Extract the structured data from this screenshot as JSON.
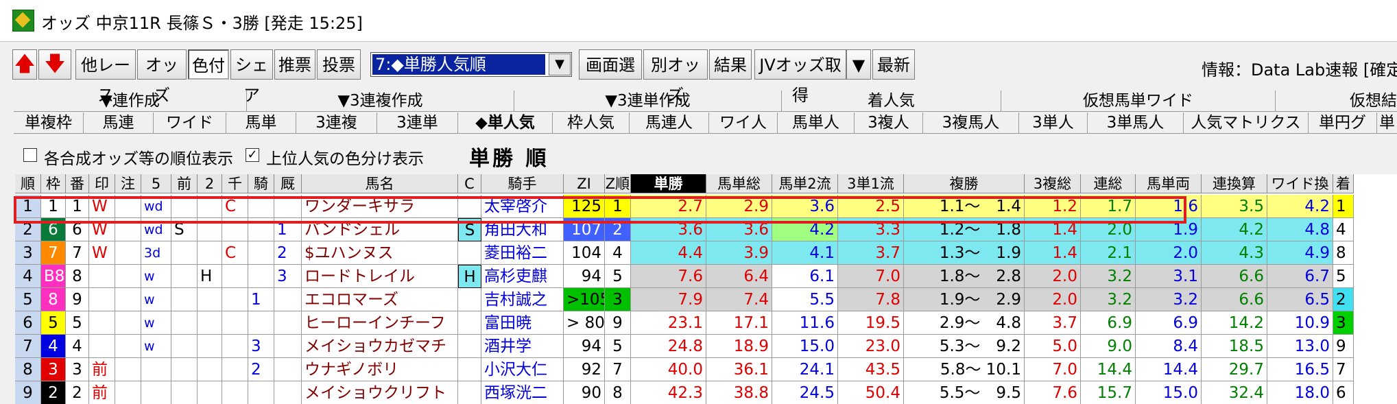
{
  "window": {
    "title": "オッズ 中京11R 長篠Ｓ・3勝 [発走 15:25]",
    "icon": "app-horse-icon"
  },
  "toolbar": {
    "up_icon": "arrow-up-icon",
    "down_icon": "arrow-down-icon",
    "other_race": "他レース",
    "odds": "オッズ",
    "color": "色付",
    "share": "シェア",
    "recommend": "推票",
    "vote": "投票",
    "sort_mode": "7:◆単勝人気順",
    "screen_select": "画面選",
    "other_odds": "別オッズ",
    "result": "結果",
    "jv_odds": "JVオッズ取得",
    "latest": "最新",
    "info": "情報：Data Lab速報 [確定"
  },
  "tabs_upper": [
    "▼連作成",
    "▼3連複作成",
    "▼3連単作成",
    "着人気",
    "仮想馬単ワイド",
    "仮想結"
  ],
  "tabs_lower": [
    "単複枠",
    "馬連",
    "ワイド",
    "馬単",
    "3連複",
    "3連単",
    "◆単人気",
    "枠人気",
    "馬連人",
    "ワイ人",
    "馬単人",
    "3複人",
    "3複馬人",
    "3単人",
    "3単馬人",
    "人気マトリクス",
    "単円グ",
    "単"
  ],
  "options": {
    "rank_display": "各合成オッズ等の順位表示",
    "rank_checked": false,
    "color_top": "上位人気の色分け表示",
    "color_checked": true,
    "heading": "単勝 順"
  },
  "colors": {
    "yellow": "#ffff80",
    "cyan": "#7de8f0",
    "green": "#a0ff80",
    "gray": "#d4d4d4",
    "red": "#e00000",
    "blue": "#0000e0",
    "dred": "#800000"
  },
  "columns": [
    "順",
    "枠",
    "番",
    "印",
    "注",
    "5",
    "前",
    "2",
    "千",
    "騎",
    "厩",
    "馬名",
    "C",
    "騎手",
    "ZI",
    "Z順",
    "単勝",
    "馬単総",
    "馬単2流",
    "3単1流",
    "複勝",
    "3複総",
    "連総",
    "馬単両",
    "連換算",
    "ワイド換",
    "着"
  ],
  "rows": [
    {
      "rank": "1",
      "waku": "1",
      "ban": "1",
      "mark": "W",
      "note": "",
      "c5": "wd",
      "mae": "",
      "c2": "",
      "sen": "C",
      "kisha": "",
      "kyu": "",
      "horse": "ワンダーキサラ",
      "c": "",
      "jockey": "太宰啓介",
      "zi": "125",
      "zr": "1",
      "win": "2.7",
      "umatan": "2.9",
      "u2": "3.6",
      "s1": "2.5",
      "place": "1.1～　1.4",
      "f3": "1.2",
      "ren": "1.7",
      "ryo": "1.6",
      "kan": "3.5",
      "wide": "4.2",
      "chaku": "1"
    },
    {
      "rank": "2",
      "waku": "6",
      "ban": "6",
      "mark": "W",
      "note": "",
      "c5": "wd",
      "mae": "S",
      "c2": "",
      "sen": "",
      "kisha": "",
      "kyu": "1",
      "horse": "バンドシェル",
      "c": "S",
      "jockey": "角田大和",
      "zi": "107",
      "zr": "2",
      "win": "3.6",
      "umatan": "3.6",
      "u2": "4.2",
      "s1": "3.3",
      "place": "1.2～　1.8",
      "f3": "1.4",
      "ren": "2.0",
      "ryo": "1.9",
      "kan": "4.2",
      "wide": "4.8",
      "chaku": "4"
    },
    {
      "rank": "3",
      "waku": "7",
      "ban": "7",
      "mark": "W",
      "note": "",
      "c5": "3d",
      "mae": "",
      "c2": "",
      "sen": "C",
      "kisha": "",
      "kyu": "2",
      "horse": "$ユハンヌス",
      "c": "",
      "jockey": "菱田裕二",
      "zi": "104",
      "zr": "4",
      "win": "4.4",
      "umatan": "3.9",
      "u2": "4.1",
      "s1": "3.7",
      "place": "1.3～　1.9",
      "f3": "1.4",
      "ren": "2.1",
      "ryo": "2.0",
      "kan": "4.3",
      "wide": "4.9",
      "chaku": "8"
    },
    {
      "rank": "4",
      "waku": "B8",
      "ban": "8",
      "mark": "",
      "note": "",
      "c5": "w",
      "mae": "",
      "c2": "H",
      "sen": "",
      "kisha": "",
      "kyu": "3",
      "horse": "ロードトレイル",
      "c": "H",
      "jockey": "高杉吏麒",
      "zi": "94",
      "zr": "5",
      "win": "7.6",
      "umatan": "6.4",
      "u2": "6.1",
      "s1": "7.0",
      "place": "1.8～　2.8",
      "f3": "2.0",
      "ren": "3.2",
      "ryo": "3.1",
      "kan": "6.6",
      "wide": "6.7",
      "chaku": "5"
    },
    {
      "rank": "5",
      "waku": "8",
      "ban": "9",
      "mark": "",
      "note": "",
      "c5": "w",
      "mae": "",
      "c2": "",
      "sen": "",
      "kisha": "1",
      "kyu": "",
      "horse": "エコロマーズ",
      "c": "",
      "jockey": "吉村誠之",
      "zi": ">105",
      "zr": "3",
      "win": "7.9",
      "umatan": "7.4",
      "u2": "5.5",
      "s1": "7.8",
      "place": "1.9～　2.9",
      "f3": "2.0",
      "ren": "3.2",
      "ryo": "3.2",
      "kan": "6.6",
      "wide": "6.5",
      "chaku": "2"
    },
    {
      "rank": "6",
      "waku": "5",
      "ban": "5",
      "mark": "",
      "note": "",
      "c5": "w",
      "mae": "",
      "c2": "",
      "sen": "",
      "kisha": "",
      "kyu": "",
      "horse": "ヒーローインチーフ",
      "c": "",
      "jockey": "富田暁",
      "zi": "> 80",
      "zr": "9",
      "win": "23.1",
      "umatan": "17.1",
      "u2": "11.6",
      "s1": "19.5",
      "place": "2.9～　4.8",
      "f3": "3.7",
      "ren": "6.9",
      "ryo": "6.9",
      "kan": "14.2",
      "wide": "10.9",
      "chaku": "3"
    },
    {
      "rank": "7",
      "waku": "4",
      "ban": "4",
      "mark": "",
      "note": "",
      "c5": "w",
      "mae": "",
      "c2": "",
      "sen": "",
      "kisha": "3",
      "kyu": "",
      "horse": "メイショウカゼマチ",
      "c": "",
      "jockey": "酒井学",
      "zi": "94",
      "zr": "5",
      "win": "24.8",
      "umatan": "18.9",
      "u2": "15.0",
      "s1": "23.0",
      "place": "5.3～　9.2",
      "f3": "5.0",
      "ren": "9.0",
      "ryo": "8.4",
      "kan": "18.5",
      "wide": "13.0",
      "chaku": "9"
    },
    {
      "rank": "8",
      "waku": "3",
      "ban": "3",
      "mark": "前",
      "note": "",
      "c5": "",
      "mae": "",
      "c2": "",
      "sen": "",
      "kisha": "2",
      "kyu": "",
      "horse": "ウナギノボリ",
      "c": "",
      "jockey": "小沢大仁",
      "zi": "92",
      "zr": "7",
      "win": "40.0",
      "umatan": "36.1",
      "u2": "24.1",
      "s1": "43.5",
      "place": "5.8～ 10.1",
      "f3": "7.0",
      "ren": "14.4",
      "ryo": "14.4",
      "kan": "29.7",
      "wide": "16.5",
      "chaku": "7"
    },
    {
      "rank": "9",
      "waku": "2",
      "ban": "2",
      "mark": "前",
      "note": "",
      "c5": "",
      "mae": "",
      "c2": "",
      "sen": "",
      "kisha": "",
      "kyu": "",
      "horse": "メイショウクリフト",
      "c": "",
      "jockey": "西塚洸二",
      "zi": "90",
      "zr": "8",
      "win": "42.3",
      "umatan": "38.8",
      "u2": "24.5",
      "s1": "50.4",
      "place": "5.5～　9.5",
      "f3": "7.6",
      "ren": "15.7",
      "ryo": "15.0",
      "kan": "32.4",
      "wide": "18.0",
      "chaku": "6"
    }
  ]
}
